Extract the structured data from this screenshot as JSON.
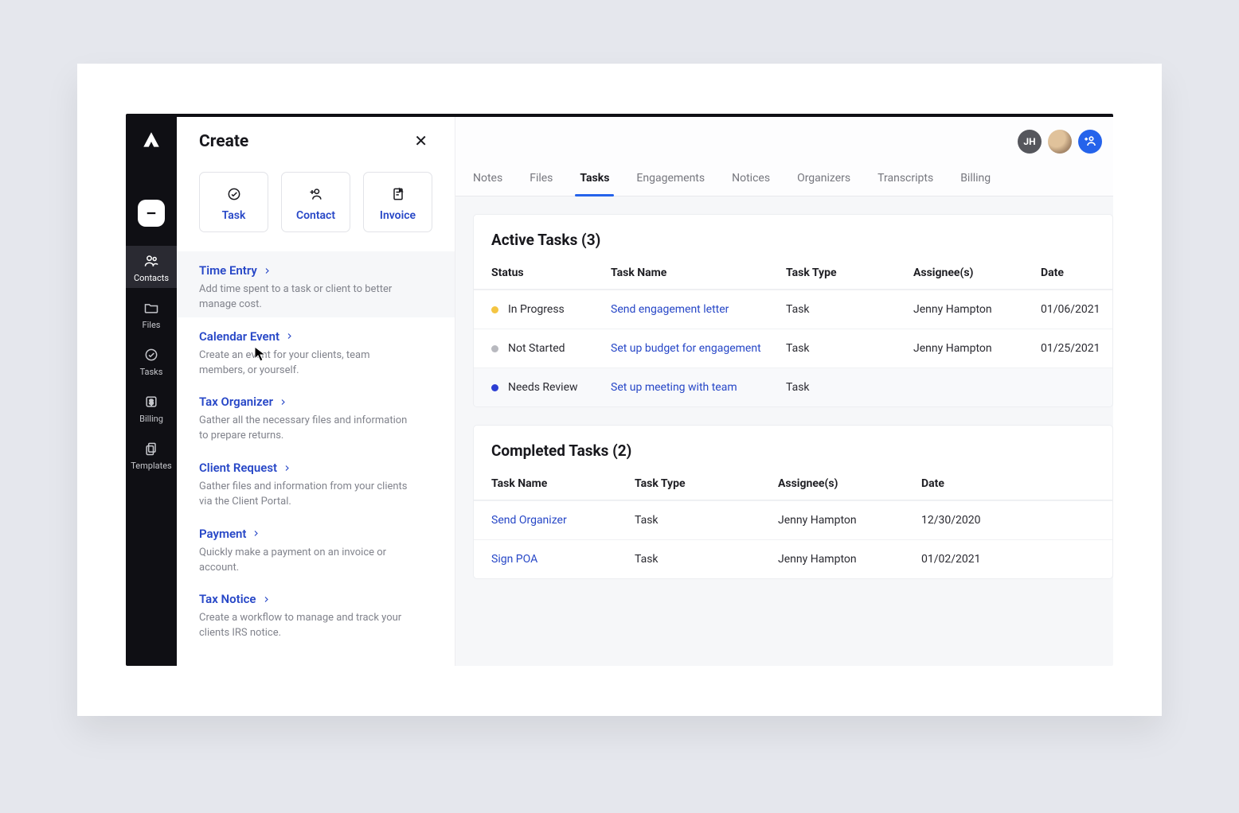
{
  "sidebar": {
    "items": [
      {
        "label": "Contacts"
      },
      {
        "label": "Files"
      },
      {
        "label": "Tasks"
      },
      {
        "label": "Billing"
      },
      {
        "label": "Templates"
      }
    ]
  },
  "create": {
    "title": "Create",
    "tiles": [
      {
        "label": "Task"
      },
      {
        "label": "Contact"
      },
      {
        "label": "Invoice"
      }
    ],
    "items": [
      {
        "title": "Time Entry",
        "desc": "Add time spent to a task or client to better manage cost."
      },
      {
        "title": "Calendar Event",
        "desc": "Create an event for your clients, team members, or yourself."
      },
      {
        "title": "Tax Organizer",
        "desc": "Gather all the necessary files and information to prepare returns."
      },
      {
        "title": "Client Request",
        "desc": "Gather files and information from your clients via the Client Portal."
      },
      {
        "title": "Payment",
        "desc": "Quickly make a payment on an invoice or account."
      },
      {
        "title": "Tax Notice",
        "desc": "Create a workflow to manage and track your clients IRS notice."
      }
    ]
  },
  "header": {
    "avatar_initials": "JH"
  },
  "tabs": [
    "Notes",
    "Files",
    "Tasks",
    "Engagements",
    "Notices",
    "Organizers",
    "Transcripts",
    "Billing"
  ],
  "active_tab_index": 2,
  "active_tasks": {
    "title": "Active Tasks (3)",
    "columns": [
      "Status",
      "Task Name",
      "Task Type",
      "Assignee(s)",
      "Date"
    ],
    "rows": [
      {
        "status": "In Progress",
        "status_color": "#f4c542",
        "task_name": "Send engagement letter",
        "task_type": "Task",
        "assignee": "Jenny Hampton",
        "date": "01/06/2021"
      },
      {
        "status": "Not Started",
        "status_color": "#b8b9bf",
        "task_name": "Set up budget for engagement",
        "task_type": "Task",
        "assignee": "Jenny Hampton",
        "date": "01/25/2021"
      },
      {
        "status": "Needs Review",
        "status_color": "#2d3fd3",
        "task_name": "Set up meeting with team",
        "task_type": "Task",
        "assignee": "",
        "date": ""
      }
    ]
  },
  "completed_tasks": {
    "title": "Completed Tasks (2)",
    "columns": [
      "Task Name",
      "Task Type",
      "Assignee(s)",
      "Date"
    ],
    "rows": [
      {
        "task_name": "Send Organizer",
        "task_type": "Task",
        "assignee": "Jenny Hampton",
        "date": "12/30/2020"
      },
      {
        "task_name": "Sign POA",
        "task_type": "Task",
        "assignee": "Jenny Hampton",
        "date": "01/02/2021"
      }
    ]
  },
  "colors": {
    "accent": "#2747c7"
  }
}
